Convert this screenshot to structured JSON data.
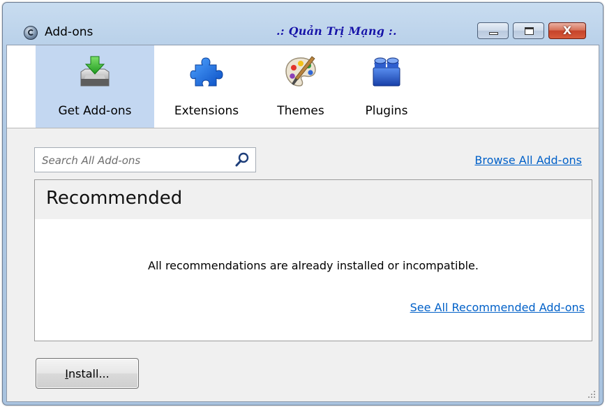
{
  "window": {
    "title": "Add-ons",
    "brand_overlay": ".: Quản Trị Mạng :.",
    "close_glyph": "X"
  },
  "toolbar": {
    "tabs": [
      {
        "label": "Get Add-ons",
        "icon": "get-addons-icon",
        "selected": true
      },
      {
        "label": "Extensions",
        "icon": "puzzle-icon",
        "selected": false
      },
      {
        "label": "Themes",
        "icon": "palette-icon",
        "selected": false
      },
      {
        "label": "Plugins",
        "icon": "lego-brick-icon",
        "selected": false
      }
    ]
  },
  "search": {
    "placeholder": "Search All Add-ons",
    "value": ""
  },
  "links": {
    "browse_all": "Browse All Add-ons"
  },
  "recommended": {
    "title": "Recommended",
    "message": "All recommendations are already installed or incompatible.",
    "see_all": "See All Recommended Add-ons"
  },
  "footer": {
    "install_label": "Install..."
  },
  "colors": {
    "selected_tab": "#c3d7f1",
    "link": "#0060c8",
    "brand": "#1515a8",
    "close_button": "#c6432a"
  }
}
